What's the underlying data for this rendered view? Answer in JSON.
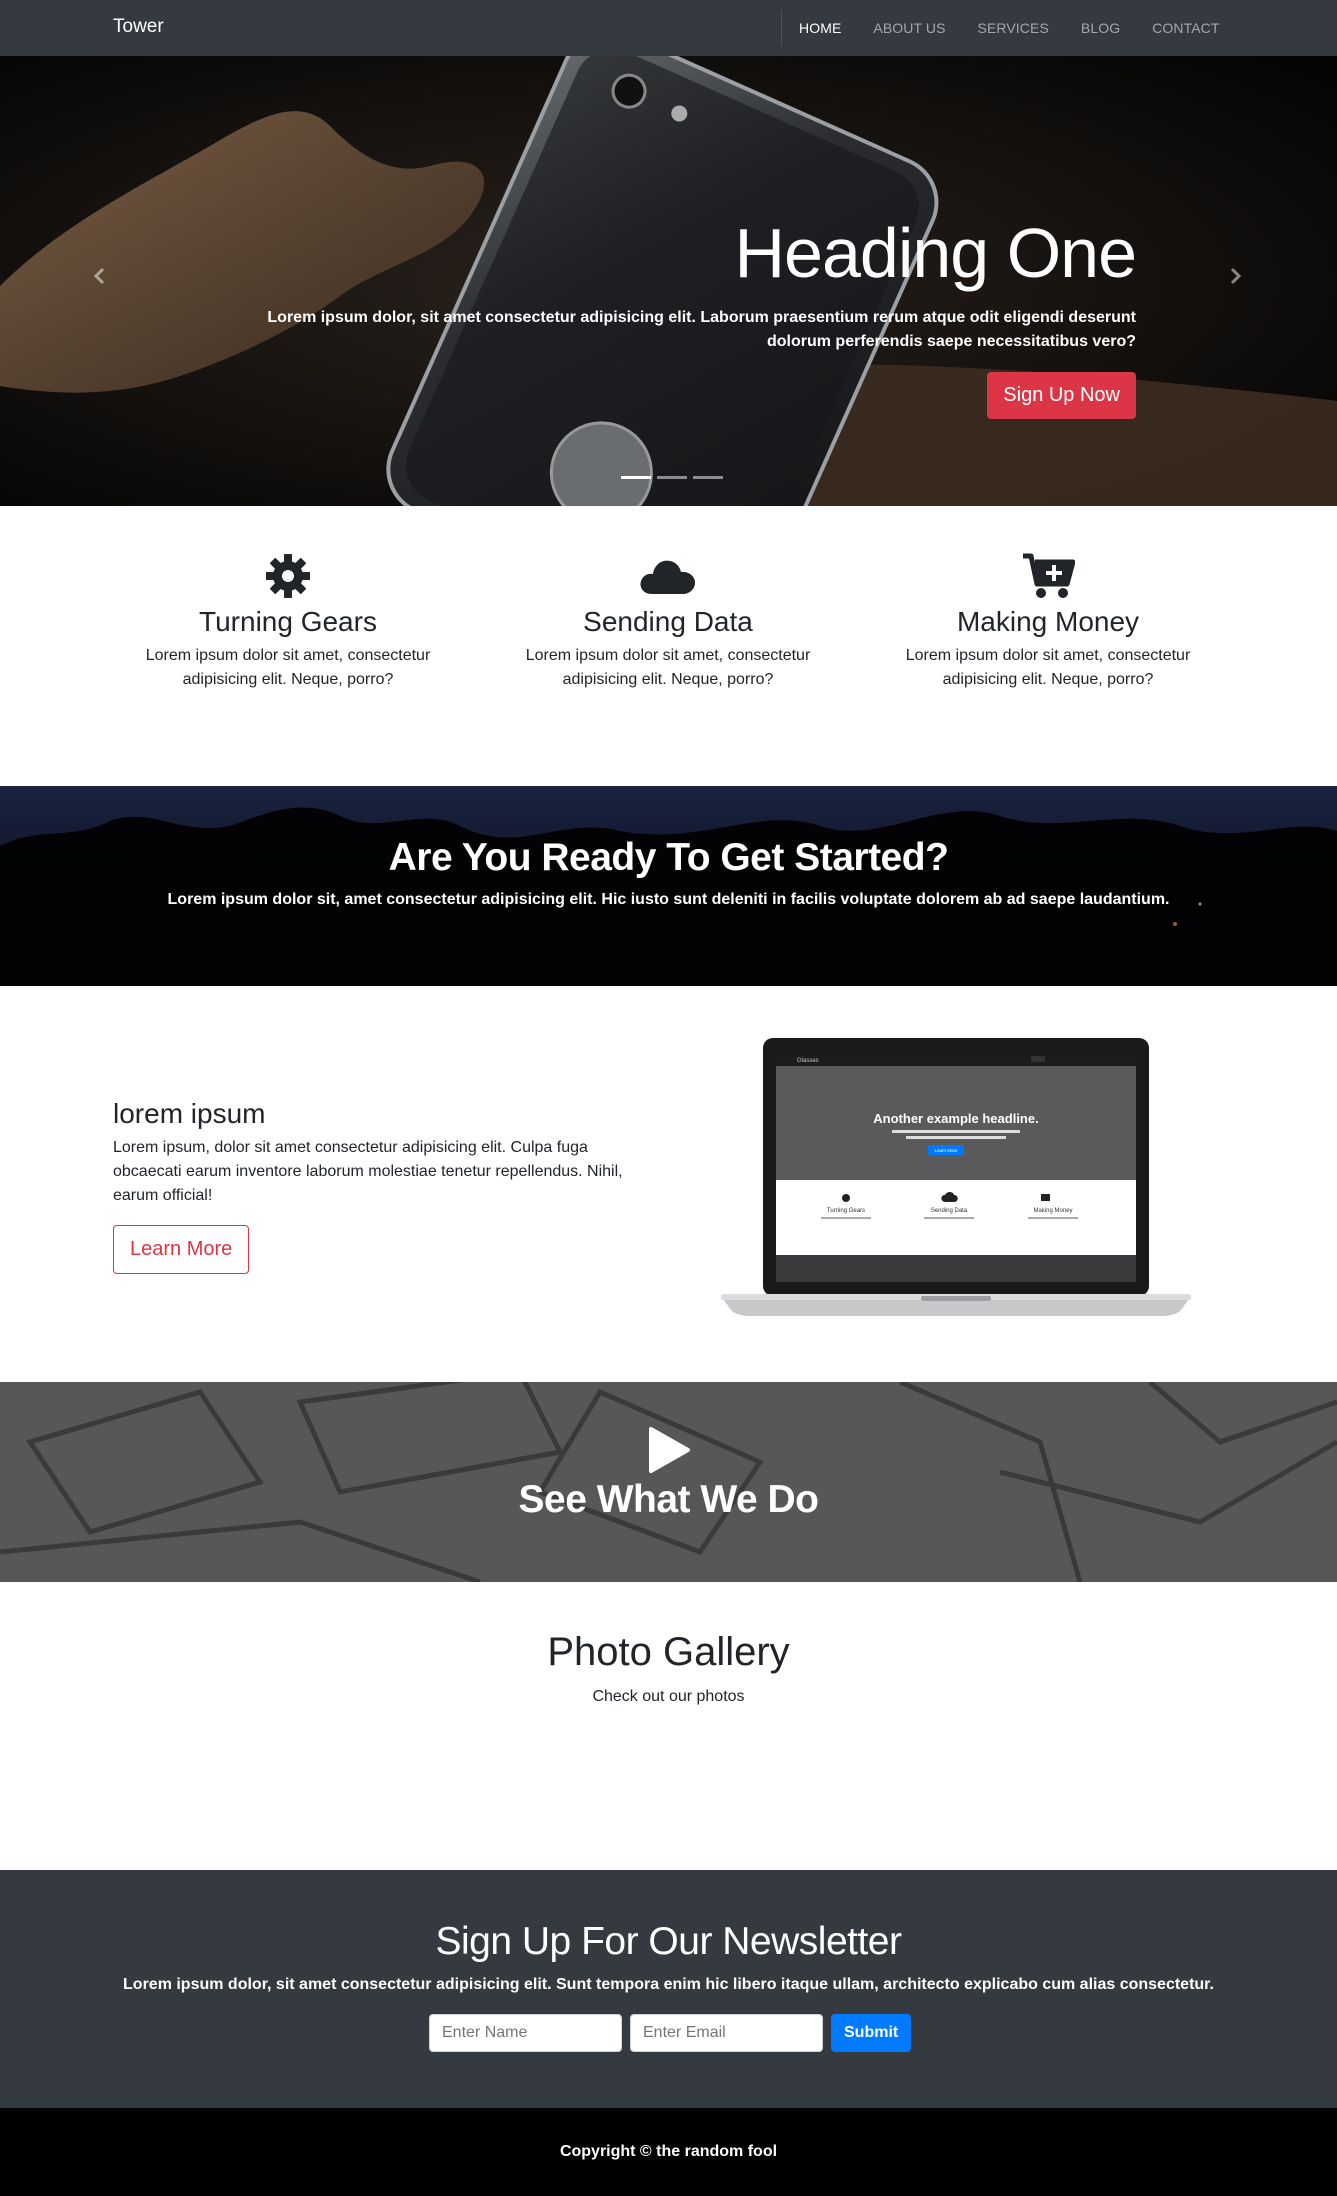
{
  "navbar": {
    "brand": "Tower",
    "links": [
      {
        "label": "HOME",
        "active": true
      },
      {
        "label": "ABOUT US",
        "active": false
      },
      {
        "label": "SERVICES",
        "active": false
      },
      {
        "label": "BLOG",
        "active": false
      },
      {
        "label": "CONTACT",
        "active": false
      }
    ]
  },
  "hero": {
    "title": "Heading One",
    "text": "Lorem ipsum dolor, sit amet consectetur adipisicing elit. Laborum praesentium rerum atque odit eligendi deserunt dolorum perferendis saepe necessitatibus vero?",
    "button": "Sign Up Now",
    "slides": 3,
    "active_slide": 1
  },
  "features": [
    {
      "icon": "gear-icon",
      "title": "Turning Gears",
      "text": "Lorem ipsum dolor sit amet, consectetur adipisicing elit. Neque, porro?"
    },
    {
      "icon": "cloud-icon",
      "title": "Sending Data",
      "text": "Lorem ipsum dolor sit amet, consectetur adipisicing elit. Neque, porro?"
    },
    {
      "icon": "cart-plus-icon",
      "title": "Making Money",
      "text": "Lorem ipsum dolor sit amet, consectetur adipisicing elit. Neque, porro?"
    }
  ],
  "cta": {
    "title": "Are You Ready To Get Started?",
    "text": "Lorem ipsum dolor sit, amet consectetur adipisicing elit. Hic iusto sunt deleniti in facilis voluptate dolorem ab ad saepe laudantium."
  },
  "info": {
    "title": "lorem ipsum",
    "text": "Lorem ipsum, dolor sit amet consectetur adipisicing elit. Culpa fuga obcaecati earum inventore laborum molestiae tenetur repellendus. Nihil, earum official!",
    "button": "Learn More",
    "laptop_screen": {
      "brand": "Glasses",
      "headline": "Another example headline.",
      "button": "Learn More",
      "features": [
        "Turning Gears",
        "Sending Data",
        "Making Money"
      ]
    }
  },
  "video": {
    "title": "See What We Do"
  },
  "gallery": {
    "title": "Photo Gallery",
    "subtitle": "Check out our photos"
  },
  "newsletter": {
    "title": "Sign Up For Our Newsletter",
    "text": "Lorem ipsum dolor, sit amet consectetur adipisicing elit. Sunt tempora enim hic libero itaque ullam, architecto explicabo cum alias consectetur.",
    "name_placeholder": "Enter Name",
    "email_placeholder": "Enter Email",
    "submit": "Submit"
  },
  "footer": {
    "copyright": "Copyright © the random fool"
  },
  "colors": {
    "navbar": "#343a40",
    "danger": "#dc3545",
    "primary": "#007bff",
    "footer": "#000000"
  }
}
